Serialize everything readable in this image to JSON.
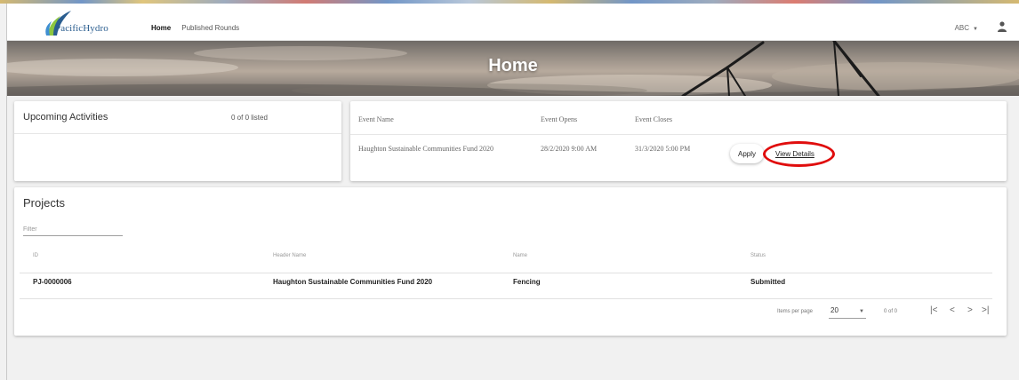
{
  "header": {
    "logo_text": "PacificHydro",
    "nav": [
      {
        "label": "Home",
        "active": true
      },
      {
        "label": "Published Rounds",
        "active": false
      }
    ],
    "user_menu": "ABC",
    "icons": {
      "user": "person-icon",
      "caret": "caret-down-icon"
    }
  },
  "banner": {
    "title": "Home"
  },
  "upcoming": {
    "title": "Upcoming Activities",
    "count_text": "0 of 0 listed"
  },
  "events": {
    "columns": [
      "Event Name",
      "Event Opens",
      "Event Closes"
    ],
    "rows": [
      {
        "name": "Haughton Sustainable Communities Fund 2020",
        "opens": "28/2/2020 9:00 AM",
        "closes": "31/3/2020 5:00 PM",
        "apply_label": "Apply",
        "details_label": "View Details"
      }
    ]
  },
  "projects": {
    "title": "Projects",
    "filter_placeholder": "Filter",
    "columns": [
      "ID",
      "Header Name",
      "Name",
      "Status"
    ],
    "rows": [
      {
        "id": "PJ-0000006",
        "header_name": "Haughton Sustainable Communities Fund 2020",
        "name": "Fencing",
        "status": "Submitted"
      }
    ],
    "paginator": {
      "items_per_page_label": "Items per page",
      "page_size": "20",
      "range_label": "0 of 0",
      "icons": [
        "first-page-icon",
        "previous-page-icon",
        "next-page-icon",
        "last-page-icon"
      ]
    }
  },
  "colors": {
    "highlight": "#e00d0d",
    "logo_blue": "#2a5d8f",
    "logo_green": "#8cc63f"
  }
}
